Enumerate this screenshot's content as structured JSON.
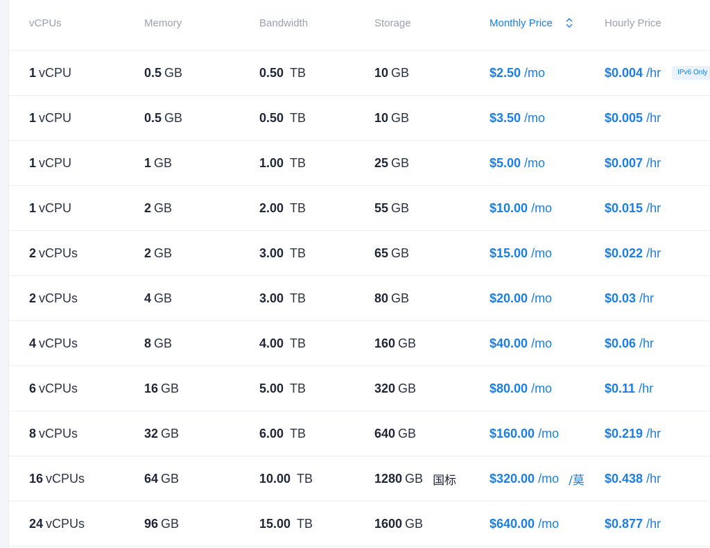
{
  "headers": {
    "vcpus": "vCPUs",
    "memory": "Memory",
    "bandwidth": "Bandwidth",
    "storage": "Storage",
    "monthly": "Monthly Price",
    "hourly": "Hourly Price"
  },
  "colors": {
    "accent": "#1a7ee6",
    "text": "#1e2636",
    "header_text": "#9aa1ad",
    "divider": "#eceef2"
  },
  "badge_label": "IPv6 Only",
  "rows": [
    {
      "cpu": "1",
      "cpu_unit": "vCPU",
      "mem": "0.5",
      "mem_unit": "GB",
      "bw": "0.50",
      "bw_unit": "TB",
      "stor": "10",
      "stor_unit": "GB",
      "month": "$2.50",
      "month_unit": "/mo",
      "hour": "$0.004",
      "hour_unit": "/hr"
    },
    {
      "cpu": "1",
      "cpu_unit": "vCPU",
      "mem": "0.5",
      "mem_unit": "GB",
      "bw": "0.50",
      "bw_unit": "TB",
      "stor": "10",
      "stor_unit": "GB",
      "month": "$3.50",
      "month_unit": "/mo",
      "hour": "$0.005",
      "hour_unit": "/hr"
    },
    {
      "cpu": "1",
      "cpu_unit": "vCPU",
      "mem": "1",
      "mem_unit": "GB",
      "bw": "1.00",
      "bw_unit": "TB",
      "stor": "25",
      "stor_unit": "GB",
      "month": "$5.00",
      "month_unit": "/mo",
      "hour": "$0.007",
      "hour_unit": "/hr"
    },
    {
      "cpu": "1",
      "cpu_unit": "vCPU",
      "mem": "2",
      "mem_unit": "GB",
      "bw": "2.00",
      "bw_unit": "TB",
      "stor": "55",
      "stor_unit": "GB",
      "month": "$10.00",
      "month_unit": "/mo",
      "hour": "$0.015",
      "hour_unit": "/hr"
    },
    {
      "cpu": "2",
      "cpu_unit": "vCPUs",
      "mem": "2",
      "mem_unit": "GB",
      "bw": "3.00",
      "bw_unit": "TB",
      "stor": "65",
      "stor_unit": "GB",
      "month": "$15.00",
      "month_unit": "/mo",
      "hour": "$0.022",
      "hour_unit": "/hr"
    },
    {
      "cpu": "2",
      "cpu_unit": "vCPUs",
      "mem": "4",
      "mem_unit": "GB",
      "bw": "3.00",
      "bw_unit": "TB",
      "stor": "80",
      "stor_unit": "GB",
      "month": "$20.00",
      "month_unit": "/mo",
      "hour": "$0.03",
      "hour_unit": "/hr"
    },
    {
      "cpu": "4",
      "cpu_unit": "vCPUs",
      "mem": "8",
      "mem_unit": "GB",
      "bw": "4.00",
      "bw_unit": "TB",
      "stor": "160",
      "stor_unit": "GB",
      "month": "$40.00",
      "month_unit": "/mo",
      "hour": "$0.06",
      "hour_unit": "/hr"
    },
    {
      "cpu": "6",
      "cpu_unit": "vCPUs",
      "mem": "16",
      "mem_unit": "GB",
      "bw": "5.00",
      "bw_unit": "TB",
      "stor": "320",
      "stor_unit": "GB",
      "month": "$80.00",
      "month_unit": "/mo",
      "hour": "$0.11",
      "hour_unit": "/hr"
    },
    {
      "cpu": "8",
      "cpu_unit": "vCPUs",
      "mem": "32",
      "mem_unit": "GB",
      "bw": "6.00",
      "bw_unit": "TB",
      "stor": "640",
      "stor_unit": "GB",
      "month": "$160.00",
      "month_unit": "/mo",
      "hour": "$0.219",
      "hour_unit": "/hr"
    },
    {
      "cpu": "16",
      "cpu_unit": "vCPUs",
      "mem": "64",
      "mem_unit": "GB",
      "bw": "10.00",
      "bw_unit": "TB",
      "stor": "1280",
      "stor_unit": "GB",
      "month": "$320.00",
      "month_unit": "/mo",
      "hour": "$0.438",
      "hour_unit": "/hr",
      "stor_extra": "国标",
      "month_extra": "/莫"
    },
    {
      "cpu": "24",
      "cpu_unit": "vCPUs",
      "mem": "96",
      "mem_unit": "GB",
      "bw": "15.00",
      "bw_unit": "TB",
      "stor": "1600",
      "stor_unit": "GB",
      "month": "$640.00",
      "month_unit": "/mo",
      "hour": "$0.877",
      "hour_unit": "/hr"
    }
  ]
}
